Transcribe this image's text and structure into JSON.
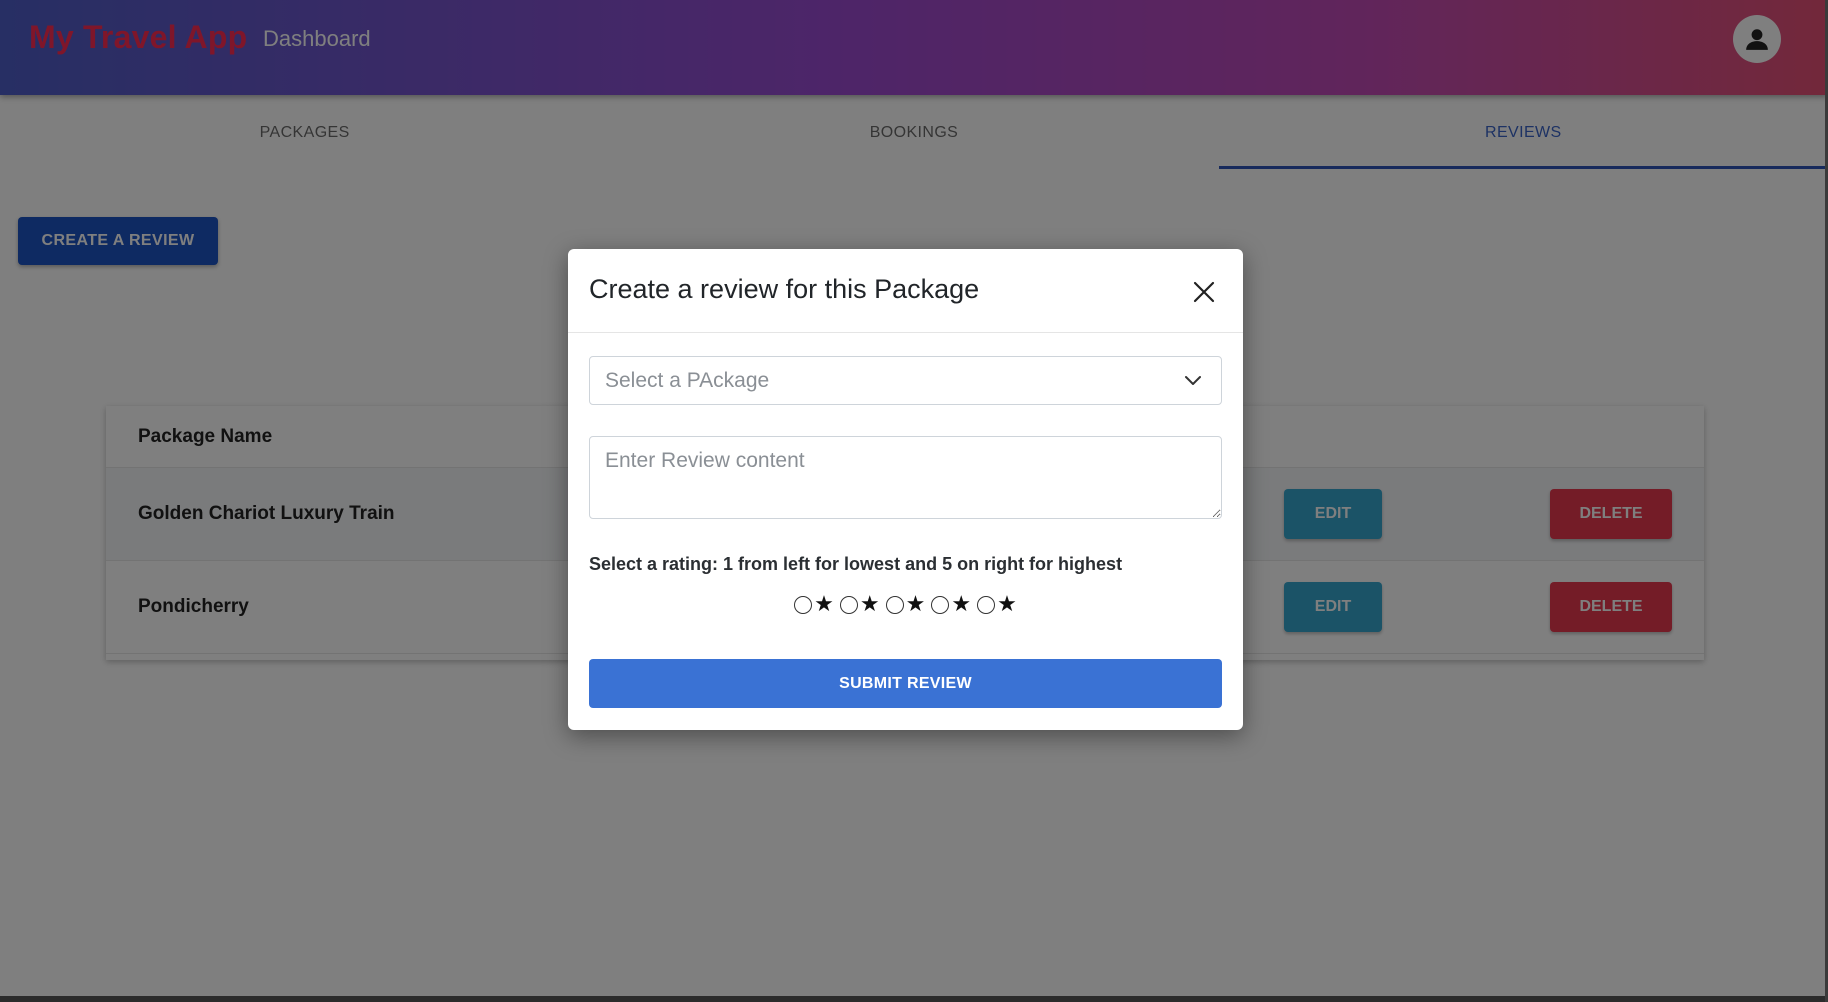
{
  "header": {
    "brand": "My Travel App",
    "nav_link": "Dashboard",
    "avatar_icon": "user-icon"
  },
  "tabs": [
    {
      "label": "PACKAGES",
      "active": false
    },
    {
      "label": "BOOKINGS",
      "active": false
    },
    {
      "label": "REVIEWS",
      "active": true
    }
  ],
  "actions": {
    "create_review_label": "CREATE A REVIEW"
  },
  "table": {
    "column_header": "Package Name",
    "rows": [
      {
        "name": "Golden Chariot Luxury Train",
        "edit_label": "EDIT",
        "delete_label": "DELETE"
      },
      {
        "name": "Pondicherry",
        "edit_label": "EDIT",
        "delete_label": "DELETE"
      }
    ]
  },
  "modal": {
    "title": "Create a review for this Package",
    "close_icon": "close-icon",
    "package_select": {
      "placeholder": "Select a PAckage",
      "icon": "chevron-down-icon"
    },
    "review_textarea": {
      "placeholder": "Enter Review content",
      "value": ""
    },
    "rating_label": "Select a rating: 1 from left for lowest and 5 on right for highest",
    "rating_options": [
      "★",
      "★",
      "★",
      "★",
      "★"
    ],
    "submit_label": "SUBMIT REVIEW"
  },
  "colors": {
    "brand": "#ff2d55",
    "active_tab": "#3b64c8",
    "primary_button": "#1d55c4",
    "edit_button": "#36a7cf",
    "delete_button": "#e8394f",
    "submit_button": "#3a72d4"
  }
}
